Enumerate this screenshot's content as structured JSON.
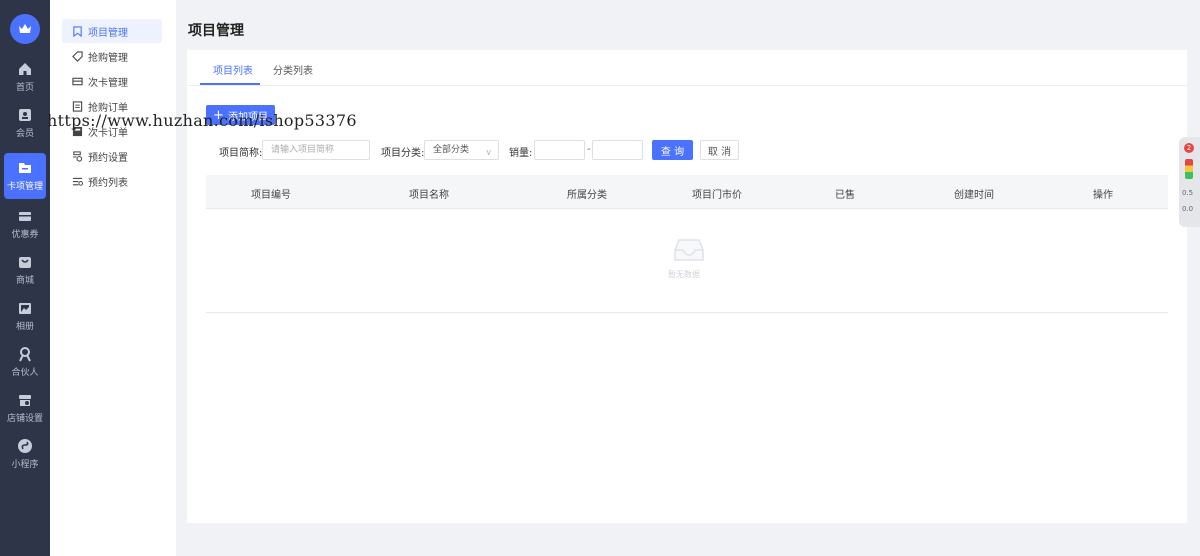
{
  "nav": {
    "items": [
      {
        "label": "首页",
        "icon": "home-icon"
      },
      {
        "label": "会员",
        "icon": "member-icon"
      },
      {
        "label": "卡项管理",
        "icon": "card-icon"
      },
      {
        "label": "优惠券",
        "icon": "coupon-icon"
      },
      {
        "label": "商城",
        "icon": "mall-icon"
      },
      {
        "label": "相册",
        "icon": "album-icon"
      },
      {
        "label": "合伙人",
        "icon": "partner-icon"
      },
      {
        "label": "店铺设置",
        "icon": "store-settings-icon"
      },
      {
        "label": "小程序",
        "icon": "miniprogram-icon"
      }
    ],
    "active_index": 2
  },
  "submenu": {
    "items": [
      {
        "label": "项目管理",
        "icon": "bookmark-icon"
      },
      {
        "label": "抢购管理",
        "icon": "tag-icon"
      },
      {
        "label": "次卡管理",
        "icon": "card-outline-icon"
      },
      {
        "label": "抢购订单",
        "icon": "order-icon"
      },
      {
        "label": "次卡订单",
        "icon": "card-order-icon"
      },
      {
        "label": "预约设置",
        "icon": "appointment-settings-icon"
      },
      {
        "label": "预约列表",
        "icon": "appointment-list-icon"
      }
    ],
    "active_index": 0
  },
  "page": {
    "title": "项目管理"
  },
  "tabs": [
    {
      "label": "项目列表"
    },
    {
      "label": "分类列表"
    }
  ],
  "toolbar": {
    "add_label": "添加项目"
  },
  "watermark": "https://www.huzhan.com/ishop53376",
  "filters": {
    "name_label": "项目简称:",
    "name_placeholder": "请输入项目简称",
    "category_label": "项目分类:",
    "category_value": "全部分类",
    "sales_label": "销量:",
    "range_sep": "-",
    "query_label": "查 询",
    "cancel_label": "取 消"
  },
  "table": {
    "columns": [
      "项目编号",
      "项目名称",
      "所属分类",
      "项目门市价",
      "已售",
      "创建时间",
      "操作"
    ],
    "rows": [],
    "empty_text": "暂无数据"
  },
  "widget": {
    "badge": "2",
    "values": [
      "0.5",
      "0.0"
    ]
  },
  "colors": {
    "accent": "#4b72ff",
    "nav_bg": "#2f3549"
  }
}
